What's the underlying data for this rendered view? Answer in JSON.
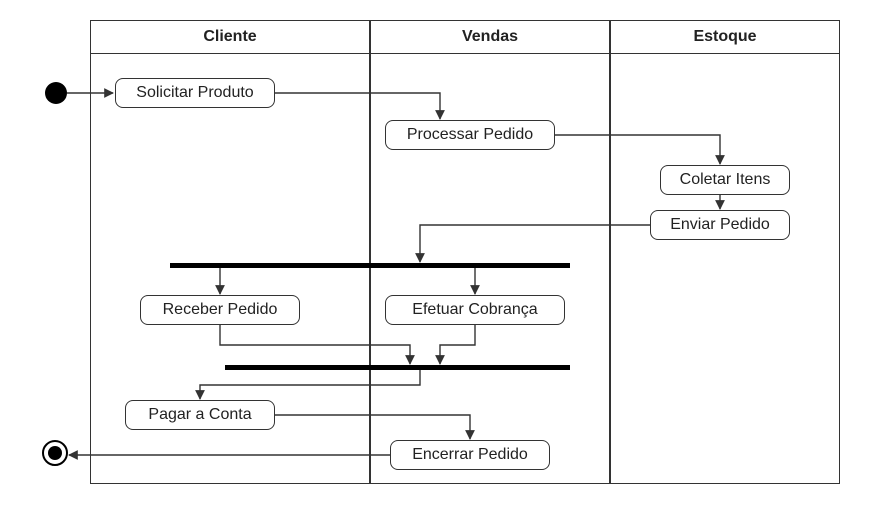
{
  "lanes": {
    "cliente": "Cliente",
    "vendas": "Vendas",
    "estoque": "Estoque"
  },
  "activities": {
    "solicitar_produto": "Solicitar Produto",
    "processar_pedido": "Processar Pedido",
    "coletar_itens": "Coletar Itens",
    "enviar_pedido": "Enviar Pedido",
    "receber_pedido": "Receber Pedido",
    "efetuar_cobranca": "Efetuar Cobrança",
    "pagar_a_conta": "Pagar a Conta",
    "encerrar_pedido": "Encerrar Pedido"
  }
}
